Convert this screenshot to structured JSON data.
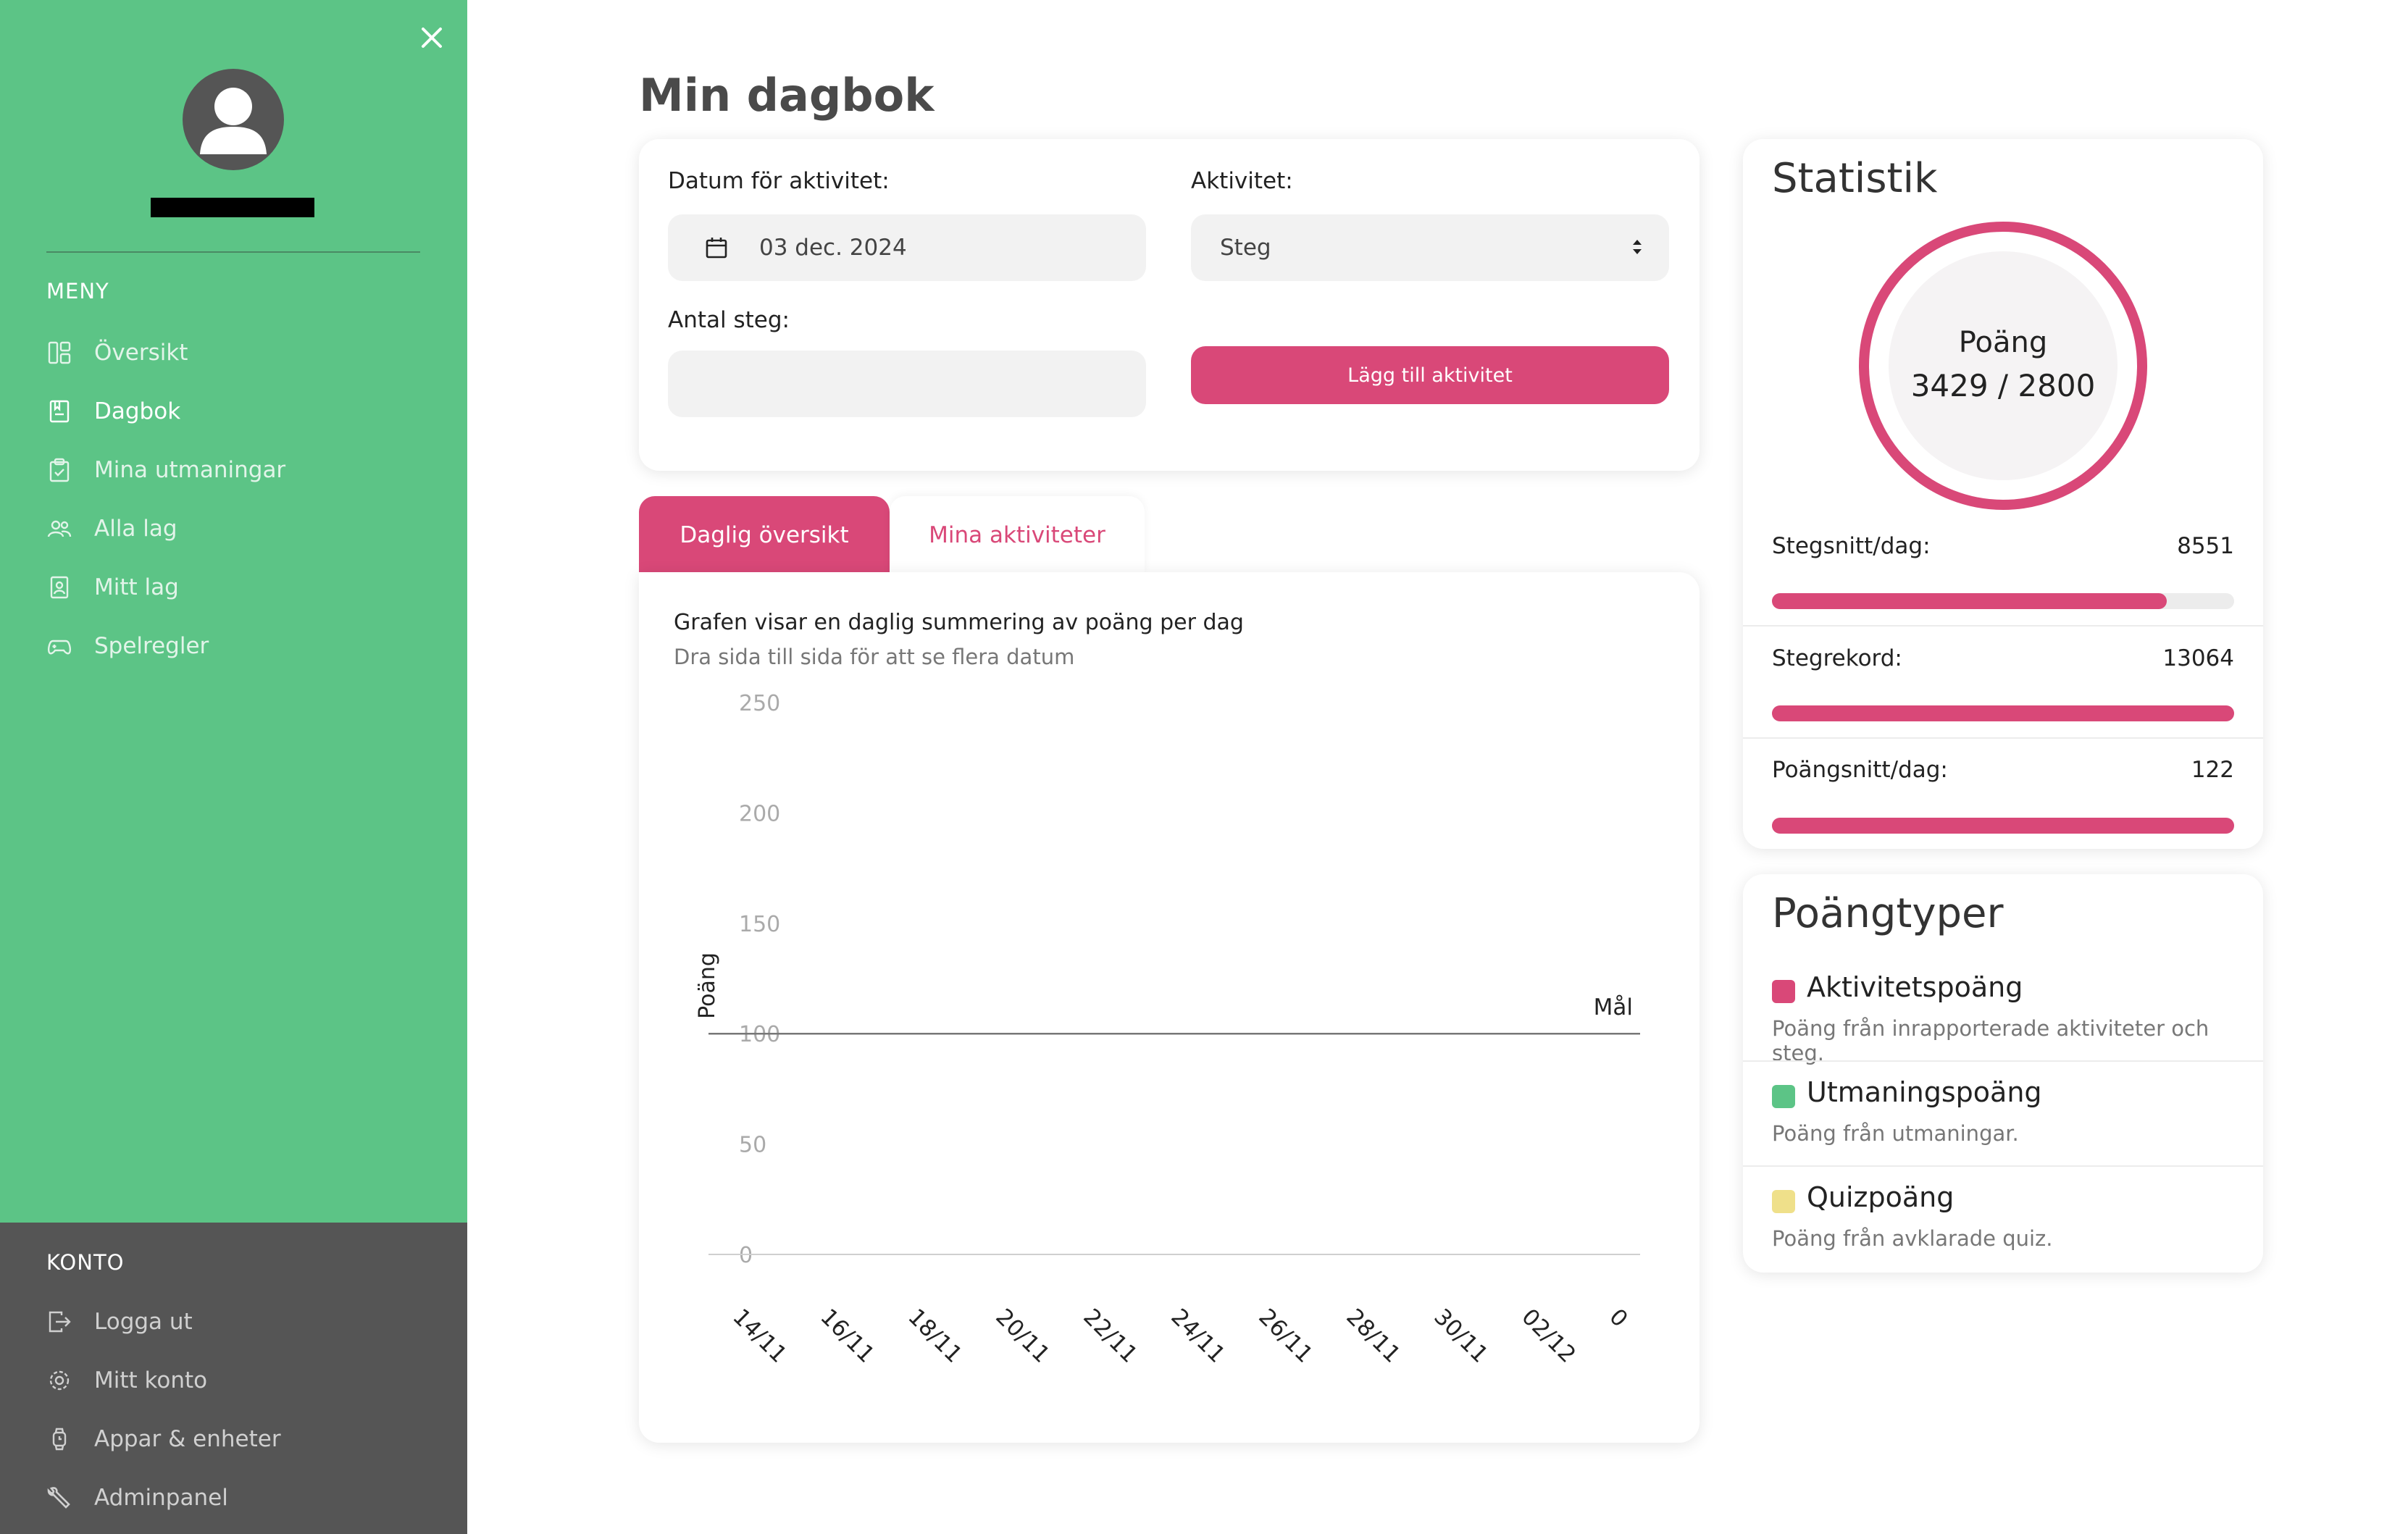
{
  "sidebar": {
    "menu_heading": "MENY",
    "items": [
      {
        "label": "Översikt",
        "icon": "layout-icon"
      },
      {
        "label": "Dagbok",
        "icon": "diary-icon"
      },
      {
        "label": "Mina utmaningar",
        "icon": "clipboard-icon"
      },
      {
        "label": "Alla lag",
        "icon": "users-icon"
      },
      {
        "label": "Mitt lag",
        "icon": "badge-icon"
      },
      {
        "label": "Spelregler",
        "icon": "gamepad-icon"
      }
    ],
    "account_heading": "KONTO",
    "account_items": [
      {
        "label": "Logga ut",
        "icon": "logout-icon"
      },
      {
        "label": "Mitt konto",
        "icon": "gear-icon"
      },
      {
        "label": "Appar & enheter",
        "icon": "watch-icon"
      },
      {
        "label": "Adminpanel",
        "icon": "wrench-icon"
      }
    ],
    "active_item": "Dagbok"
  },
  "main": {
    "title": "Min dagbok",
    "form": {
      "date_label": "Datum för aktivitet:",
      "date_value": "03 dec. 2024",
      "activity_label": "Aktivitet:",
      "activity_value": "Steg",
      "steps_label": "Antal steg:",
      "steps_value": "",
      "add_button": "Lägg till aktivitet"
    },
    "tabs": [
      {
        "label": "Daglig översikt",
        "active": true
      },
      {
        "label": "Mina aktiviteter",
        "active": false
      }
    ],
    "chart_title": "Grafen visar en daglig summering av poäng per dag",
    "chart_subtitle": "Dra sida till sida för att se flera datum"
  },
  "chart_data": {
    "type": "bar",
    "categories": [
      "14/11",
      "16/11",
      "18/11",
      "20/11",
      "22/11",
      "24/11",
      "26/11",
      "28/11",
      "30/11",
      "02/12",
      "0"
    ],
    "values": [
      0,
      0,
      0,
      0,
      0,
      0,
      0,
      0,
      0,
      0,
      0
    ],
    "ylabel": "Poäng",
    "xlabel": "",
    "ylim": [
      0,
      250
    ],
    "yticks": [
      0,
      50,
      100,
      150,
      200,
      250
    ],
    "goal_line": {
      "value": 100,
      "label": "Mål"
    },
    "grid": false
  },
  "stats": {
    "title": "Statistik",
    "ring_label": "Poäng",
    "ring_value": "3429 / 2800",
    "ring_fraction": 1.0,
    "rows": [
      {
        "label": "Stegsnitt/dag:",
        "value": "8551",
        "fill": 0.855
      },
      {
        "label": "Stegrekord:",
        "value": "13064",
        "fill": 1.0
      },
      {
        "label": "Poängsnitt/dag:",
        "value": "122",
        "fill": 1.0
      }
    ]
  },
  "point_types": {
    "title": "Poängtyper",
    "items": [
      {
        "name": "Aktivitetspoäng",
        "desc": "Poäng från inrapporterade aktiviteter och steg.",
        "color": "#d94878"
      },
      {
        "name": "Utmaningspoäng",
        "desc": "Poäng från utmaningar.",
        "color": "#5cc486"
      },
      {
        "name": "Quizpoäng",
        "desc": "Poäng från avklarade quiz.",
        "color": "#efe08a"
      }
    ]
  },
  "colors": {
    "accent": "#d94878",
    "sidebar": "#5cc486",
    "sidebar_dark": "#555555"
  }
}
